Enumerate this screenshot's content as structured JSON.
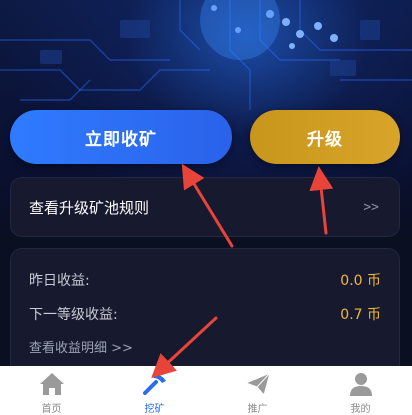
{
  "actions": {
    "collect_label": "立即收矿",
    "upgrade_label": "升级"
  },
  "rules_card": {
    "label": "查看升级矿池规则",
    "arrow": ">>"
  },
  "earnings": {
    "rows": [
      {
        "label": "昨日收益:",
        "value": "0.0 币"
      },
      {
        "label": "下一等级收益:",
        "value": "0.7 币"
      }
    ],
    "detail_link": "查看收益明细 >>"
  },
  "tabbar": {
    "items": [
      {
        "label": "首页",
        "icon": "home-icon",
        "active": false
      },
      {
        "label": "挖矿",
        "icon": "pickaxe-icon",
        "active": true
      },
      {
        "label": "推广",
        "icon": "paper-plane-icon",
        "active": false
      },
      {
        "label": "我的",
        "icon": "user-icon",
        "active": false
      }
    ]
  },
  "colors": {
    "background": "#0b0f22",
    "primary_button": "#2f7bff",
    "upgrade_button": "#d0a024",
    "value_text": "#f2b637",
    "active_tab": "#2a6cf0",
    "annotation_arrow": "#e8443a"
  }
}
